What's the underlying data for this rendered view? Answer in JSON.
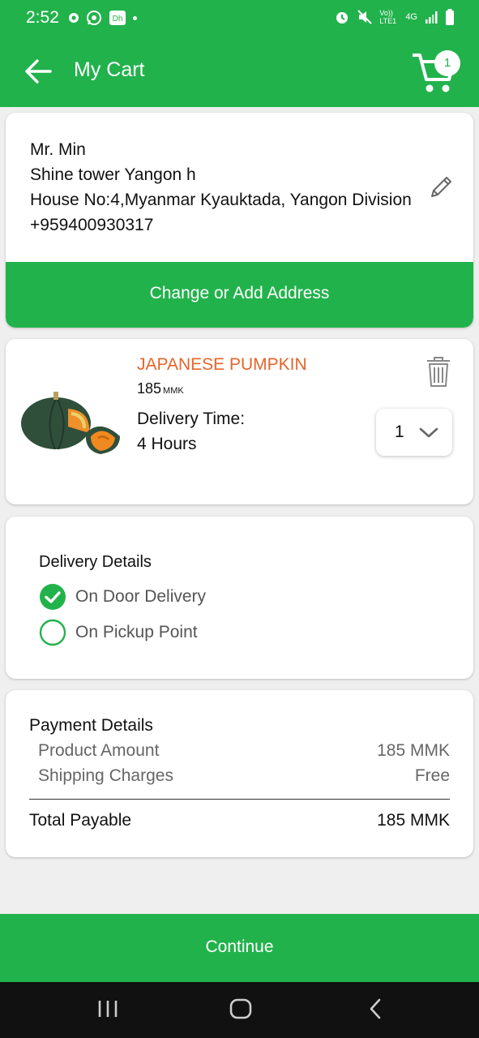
{
  "status_bar": {
    "time": "2:52",
    "left_icons": [
      "google-icon",
      "whatsapp-icon",
      "dh-icon",
      "dot-icon"
    ],
    "right_icons": [
      "alarm-icon",
      "mute-icon",
      "volte-icon",
      "4g-icon",
      "signal-icon",
      "battery-icon"
    ],
    "volte_label": "Vo)) LTE1",
    "network_label": "4G"
  },
  "header": {
    "title": "My Cart",
    "cart_badge_count": "1"
  },
  "address": {
    "name": "Mr. Min",
    "line1": "Shine tower Yangon h",
    "line2": "House No:4,Myanmar Kyauktada, Yangon Division",
    "phone": "+959400930317",
    "change_button": "Change or Add Address"
  },
  "cart_item": {
    "name": "JAPANESE PUMPKIN",
    "price": "185",
    "currency": "MMK",
    "delivery_time_label": "Delivery Time:",
    "delivery_time_value": "4 Hours",
    "quantity": "1"
  },
  "delivery": {
    "heading": "Delivery Details",
    "options": [
      {
        "label": "On Door Delivery",
        "selected": true
      },
      {
        "label": "On Pickup Point",
        "selected": false
      }
    ]
  },
  "payment": {
    "heading": "Payment Details",
    "rows": [
      {
        "label": "Product Amount",
        "value": "185 MMK"
      },
      {
        "label": "Shipping Charges",
        "value": "Free"
      }
    ],
    "total_label": "Total Payable",
    "total_value": "185 MMK"
  },
  "footer": {
    "continue_label": "Continue"
  },
  "colors": {
    "brand_green": "#22b24c",
    "product_name_orange": "#e5652c"
  }
}
